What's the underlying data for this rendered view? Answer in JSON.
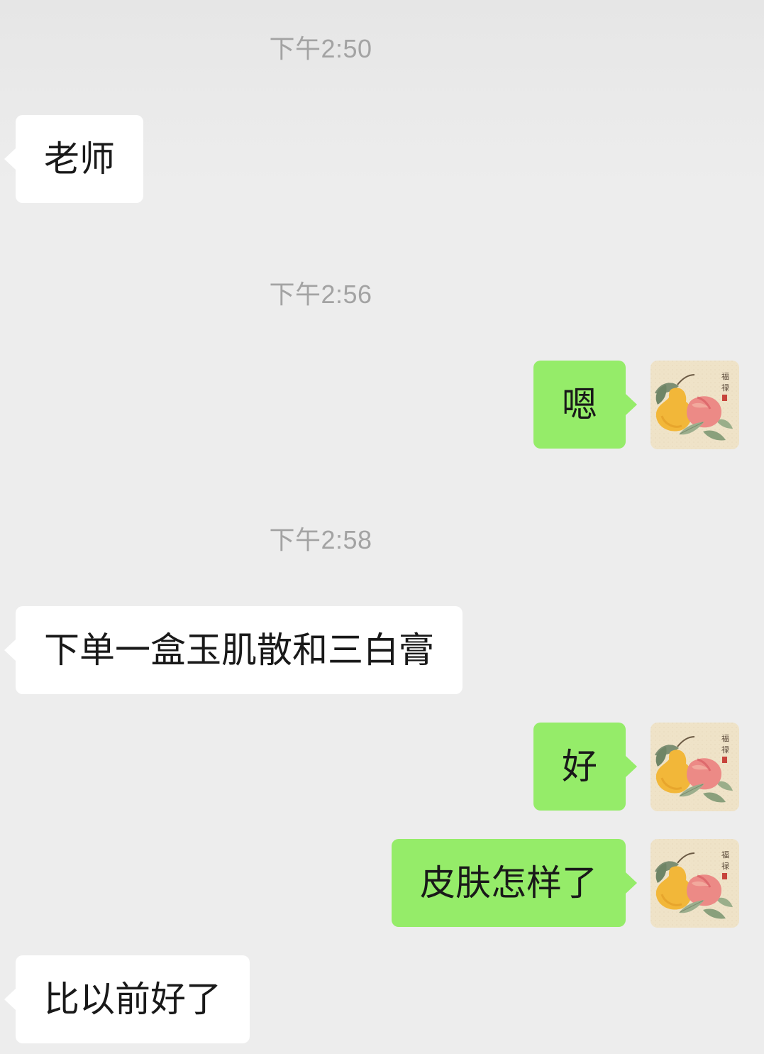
{
  "messages": [
    {
      "type": "time",
      "text": "下午2:50"
    },
    {
      "type": "in",
      "text": "老师"
    },
    {
      "type": "time",
      "text": "下午2:56"
    },
    {
      "type": "out",
      "text": "嗯",
      "avatar": "peach-pear-painting-avatar"
    },
    {
      "type": "time",
      "text": "下午2:58"
    },
    {
      "type": "in",
      "text": "下单一盒玉肌散和三白膏"
    },
    {
      "type": "out",
      "text": "好",
      "avatar": "peach-pear-painting-avatar"
    },
    {
      "type": "out",
      "text": "皮肤怎样了",
      "avatar": "peach-pear-painting-avatar"
    },
    {
      "type": "in",
      "text": "比以前好了"
    }
  ],
  "avatar": {
    "inscription": "福禄",
    "icon": "peach-pear-painting"
  },
  "colors": {
    "background": "#ededed",
    "incoming_bubble": "#ffffff",
    "outgoing_bubble": "#95ec69",
    "timestamp_text": "#a3a3a3",
    "message_text": "#191919"
  }
}
